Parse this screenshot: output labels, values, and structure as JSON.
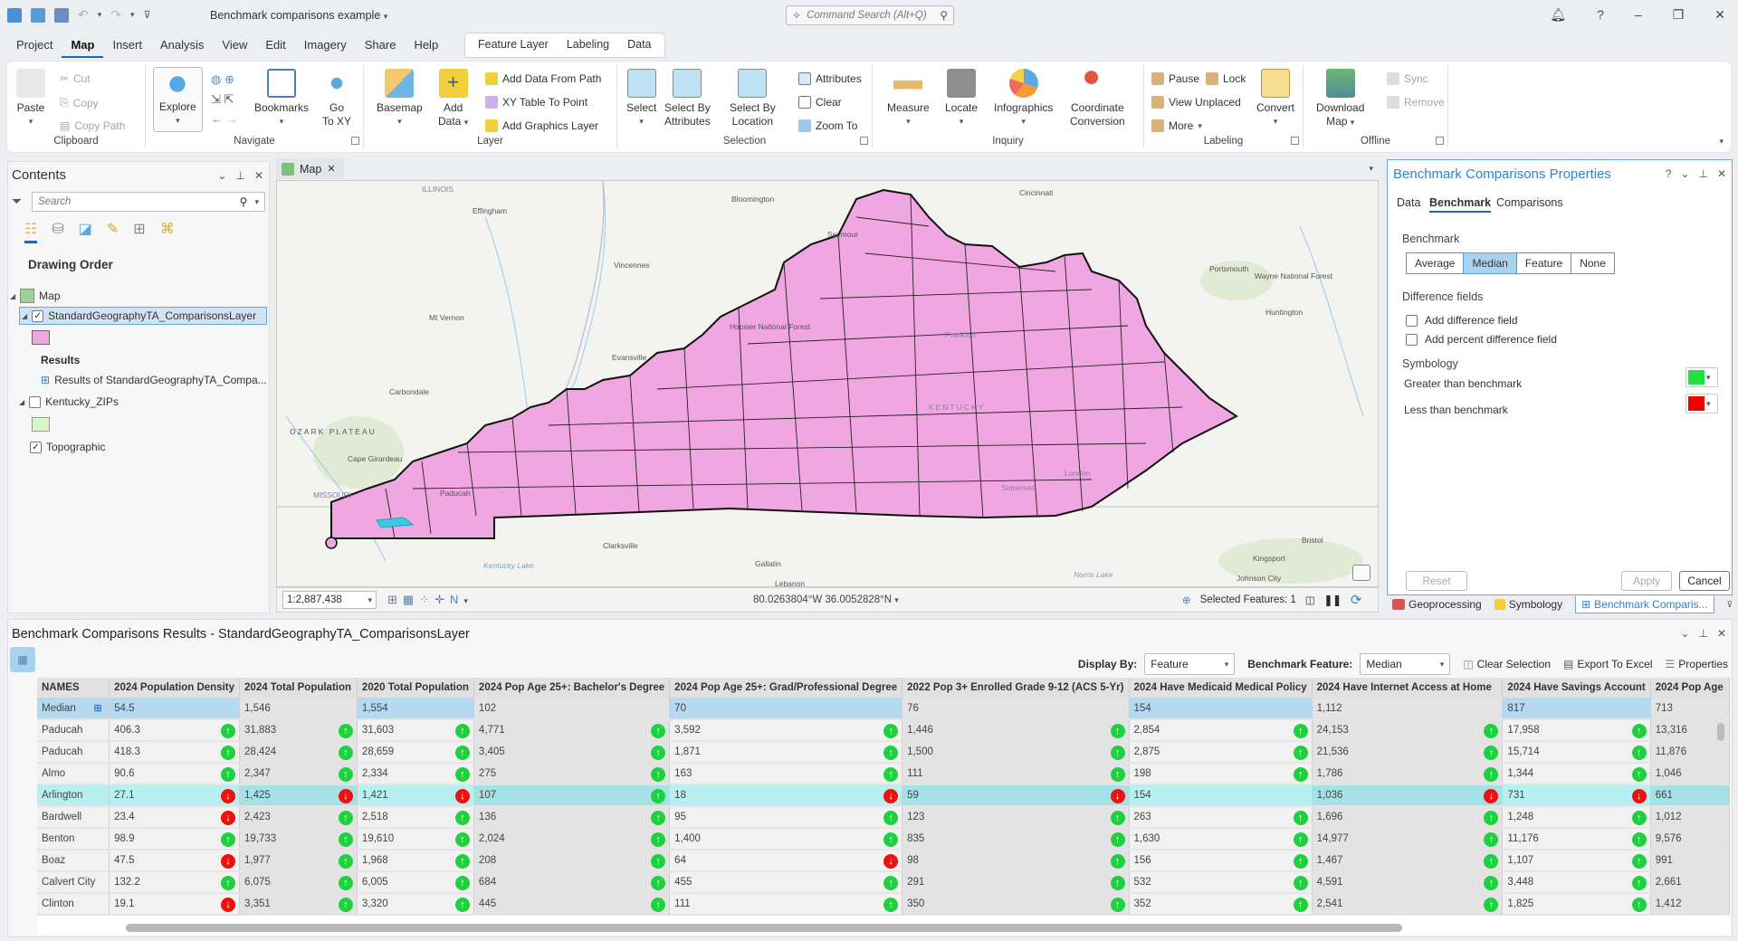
{
  "app": {
    "title": "Benchmark comparisons example",
    "command_search_placeholder": "Command Search (Alt+Q)"
  },
  "menu_tabs": [
    "Project",
    "Map",
    "Insert",
    "Analysis",
    "View",
    "Edit",
    "Imagery",
    "Share",
    "Help"
  ],
  "active_menu_tab": "Map",
  "context_tabs": [
    "Feature Layer",
    "Labeling",
    "Data"
  ],
  "ribbon": {
    "clipboard": {
      "label": "Clipboard",
      "paste": "Paste",
      "cut": "Cut",
      "copy": "Copy",
      "copy_path": "Copy Path"
    },
    "navigate": {
      "label": "Navigate",
      "explore": "Explore",
      "bookmarks": "Bookmarks",
      "goto_xy_1": "Go",
      "goto_xy_2": "To XY"
    },
    "layer": {
      "label": "Layer",
      "basemap": "Basemap",
      "add_data_1": "Add",
      "add_data_2": "Data",
      "add_data_from_path": "Add Data From Path",
      "xy_table_to_point": "XY Table To Point",
      "add_graphics_layer": "Add Graphics Layer"
    },
    "selection": {
      "label": "Selection",
      "select": "Select",
      "select_by_attributes_1": "Select By",
      "select_by_attributes_2": "Attributes",
      "select_by_location_1": "Select By",
      "select_by_location_2": "Location",
      "attributes": "Attributes",
      "clear": "Clear",
      "zoom_to": "Zoom To"
    },
    "inquiry": {
      "label": "Inquiry",
      "measure": "Measure",
      "locate": "Locate",
      "infographics": "Infographics",
      "coord_conv_1": "Coordinate",
      "coord_conv_2": "Conversion"
    },
    "labeling": {
      "label": "Labeling",
      "pause": "Pause",
      "lock": "Lock",
      "view_unplaced": "View Unplaced",
      "more": "More",
      "convert": "Convert"
    },
    "offline": {
      "label": "Offline",
      "download_map_1": "Download",
      "download_map_2": "Map",
      "sync": "Sync",
      "remove": "Remove"
    }
  },
  "contents": {
    "title": "Contents",
    "search_placeholder": "Search",
    "drawing_order": "Drawing Order",
    "map_node": "Map",
    "layer1": "StandardGeographyTA_ComparisonsLayer",
    "layer1_color": "#f0a6e0",
    "results_heading": "Results",
    "results_item": "Results of StandardGeographyTA_Compa...",
    "layer2": "Kentucky_ZIPs",
    "layer2_color": "#d4f7c5",
    "layer3": "Topographic"
  },
  "map": {
    "tab_label": "Map",
    "scale": "1:2,887,438",
    "coordinates": "80.0263804°W 36.0052828°N",
    "selected_features": "Selected Features: 1",
    "labels": [
      "ILLINOIS",
      "Effingham",
      "Bloomington",
      "Seymour",
      "Cincinnati",
      "Vincennes",
      "Mt Vernon",
      "Evansville",
      "Carbondale",
      "OZARK PLATEAU",
      "MISSOURI",
      "Cape Girardeau",
      "Hoosier National Forest",
      "Paducah",
      "Clarksville",
      "Gallatin",
      "Lebanon",
      "Kingsport",
      "Johnson City",
      "Bristol",
      "Huntington",
      "Portsmouth",
      "Wayne National Forest",
      "Frankfort",
      "KENTUCKY",
      "London",
      "Somerset",
      "Norris Lake",
      "Kentucky Lake"
    ]
  },
  "properties": {
    "title": "Benchmark Comparisons Properties",
    "tabs": [
      "Data",
      "Benchmark",
      "Comparisons"
    ],
    "active_tab": "Benchmark",
    "benchmark_label": "Benchmark",
    "benchmark_options": [
      "Average",
      "Median",
      "Feature",
      "None"
    ],
    "benchmark_selected": "Median",
    "difference_fields_label": "Difference fields",
    "add_difference_field": "Add difference field",
    "add_percent_difference_field": "Add percent difference field",
    "symbology_label": "Symbology",
    "greater_than": "Greater than benchmark",
    "greater_color": "#22dd44",
    "less_than": "Less than benchmark",
    "less_color": "#ee0000",
    "reset": "Reset",
    "apply": "Apply",
    "cancel": "Cancel"
  },
  "dock_tabs": [
    "Geoprocessing",
    "Symbology",
    "Benchmark Comparis..."
  ],
  "results": {
    "title": "Benchmark Comparisons Results - StandardGeographyTA_ComparisonsLayer",
    "display_by_label": "Display By:",
    "display_by_value": "Feature",
    "benchmark_feature_label": "Benchmark Feature:",
    "benchmark_feature_value": "Median",
    "clear_selection": "Clear Selection",
    "export_to_excel": "Export To Excel",
    "properties": "Properties",
    "columns": [
      "NAMES",
      "2024 Population Density",
      "2024 Total Population",
      "2020 Total Population",
      "2024 Pop Age 25+: Bachelor's Degree",
      "2024 Pop Age 25+: Grad/Professional Degree",
      "2022 Pop 3+ Enrolled Grade 9-12 (ACS 5-Yr)",
      "2024 Have Medicaid Medical Policy",
      "2024 Have Internet Access at Home",
      "2024 Have Savings Account",
      "2024 Pop Age"
    ],
    "rows": [
      {
        "name": "Median",
        "type": "median",
        "values": [
          "54.5",
          "1,546",
          "1,554",
          "102",
          "70",
          "76",
          "154",
          "1,112",
          "817",
          "713"
        ],
        "ind": [
          "",
          "",
          "",
          "",
          "",
          "",
          "",
          "",
          "",
          ""
        ]
      },
      {
        "name": "Paducah",
        "type": "normal",
        "values": [
          "406.3",
          "31,883",
          "31,603",
          "4,771",
          "3,592",
          "1,446",
          "2,854",
          "24,153",
          "17,958",
          "13,316"
        ],
        "ind": [
          "up",
          "up",
          "up",
          "up",
          "up",
          "up",
          "up",
          "up",
          "up",
          ""
        ]
      },
      {
        "name": "Paducah",
        "type": "normal",
        "values": [
          "418.3",
          "28,424",
          "28,659",
          "3,405",
          "1,871",
          "1,500",
          "2,875",
          "21,536",
          "15,714",
          "11,876"
        ],
        "ind": [
          "up",
          "up",
          "up",
          "up",
          "up",
          "up",
          "up",
          "up",
          "up",
          ""
        ]
      },
      {
        "name": "Almo",
        "type": "normal",
        "values": [
          "90.6",
          "2,347",
          "2,334",
          "275",
          "163",
          "111",
          "198",
          "1,786",
          "1,344",
          "1,046"
        ],
        "ind": [
          "up",
          "up",
          "up",
          "up",
          "up",
          "up",
          "up",
          "up",
          "up",
          ""
        ]
      },
      {
        "name": "Arlington",
        "type": "highlight",
        "values": [
          "27.1",
          "1,425",
          "1,421",
          "107",
          "18",
          "59",
          "154",
          "1,036",
          "731",
          "661"
        ],
        "ind": [
          "down",
          "down",
          "down",
          "up",
          "down",
          "down",
          "",
          "down",
          "down",
          ""
        ]
      },
      {
        "name": "Bardwell",
        "type": "normal",
        "values": [
          "23.4",
          "2,423",
          "2,518",
          "136",
          "95",
          "123",
          "263",
          "1,696",
          "1,248",
          "1,012"
        ],
        "ind": [
          "down",
          "up",
          "up",
          "up",
          "up",
          "up",
          "up",
          "up",
          "up",
          ""
        ]
      },
      {
        "name": "Benton",
        "type": "normal",
        "values": [
          "98.9",
          "19,733",
          "19,610",
          "2,024",
          "1,400",
          "835",
          "1,630",
          "14,977",
          "11,176",
          "9,576"
        ],
        "ind": [
          "up",
          "up",
          "up",
          "up",
          "up",
          "up",
          "up",
          "up",
          "up",
          ""
        ]
      },
      {
        "name": "Boaz",
        "type": "normal",
        "values": [
          "47.5",
          "1,977",
          "1,968",
          "208",
          "64",
          "98",
          "156",
          "1,467",
          "1,107",
          "991"
        ],
        "ind": [
          "down",
          "up",
          "up",
          "up",
          "down",
          "up",
          "up",
          "up",
          "up",
          ""
        ]
      },
      {
        "name": "Calvert City",
        "type": "normal",
        "values": [
          "132.2",
          "6,075",
          "6,005",
          "684",
          "455",
          "291",
          "532",
          "4,591",
          "3,448",
          "2,661"
        ],
        "ind": [
          "up",
          "up",
          "up",
          "up",
          "up",
          "up",
          "up",
          "up",
          "up",
          ""
        ]
      },
      {
        "name": "Clinton",
        "type": "normal",
        "values": [
          "19.1",
          "3,351",
          "3,320",
          "445",
          "111",
          "350",
          "352",
          "2,541",
          "1,825",
          "1,412"
        ],
        "ind": [
          "down",
          "up",
          "up",
          "up",
          "up",
          "up",
          "up",
          "up",
          "up",
          ""
        ]
      }
    ]
  }
}
